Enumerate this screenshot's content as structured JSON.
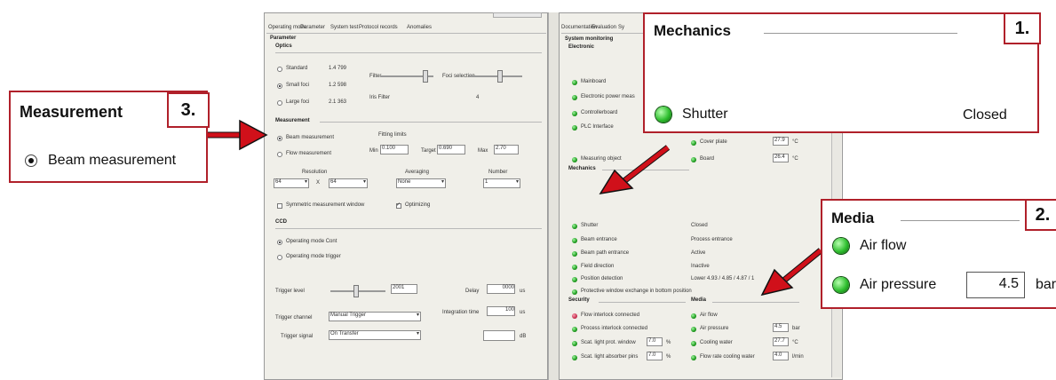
{
  "left_window": {
    "tabs": [
      "Operating mode",
      "Parameter",
      "System test",
      "Protocol records",
      "Anomalies"
    ],
    "group_title": "Parameter",
    "optics": {
      "title": "Optics",
      "options": [
        "Standard",
        "Small foci",
        "Large foci"
      ],
      "values": [
        "1.4 799",
        "1.2 598",
        "2.1 363"
      ],
      "slider1_label": "Filter",
      "slider2_label": "Foci selection",
      "extra_label": "Iris Filter",
      "extra_value": "4"
    },
    "measurement": {
      "title": "Measurement",
      "options": [
        "Beam measurement",
        "Flow measurement"
      ],
      "fitting_label": "Fitting limits",
      "min_label": "Min",
      "min_value": "0.100",
      "target_label": "Target",
      "target_value": "0.690",
      "max_label": "Max",
      "max_value": "2.70",
      "resolution_label": "Resolution",
      "averaging_label": "Averaging",
      "number_label": "Number",
      "res_x": "64",
      "res_x_sep": "X",
      "res_y": "64",
      "averaging_value": "None",
      "number_value": "1",
      "symmetric_label": "Symmetric measurement window",
      "optimizing_label": "Optimizing"
    },
    "ccd": {
      "title": "CCD",
      "options": [
        "Operating mode Cont",
        "Operating mode trigger"
      ],
      "trigger_level_label": "Trigger level",
      "trigger_level_value": "2001",
      "delay_label": "Delay",
      "delay_value": "0000",
      "delay_unit": "us",
      "integration_label": "Integration time",
      "integration_value": "100",
      "integration_unit": "us",
      "trigger_channel_label": "Trigger channel",
      "trigger_channel_value": "Manual Trigger",
      "trigger_signal_label": "Trigger signal",
      "trigger_signal_value": "On Transfer",
      "db_unit": "dB"
    }
  },
  "right_window": {
    "tabs": [
      "Documentation",
      "Evaluation",
      "Sy"
    ],
    "group_title": "System monitoring",
    "electronic": {
      "title": "Electronic",
      "items": [
        "Mainboard",
        "Electronic power meas",
        "Controllerboard",
        "PLC Interface"
      ]
    },
    "temps": [
      {
        "label": "Cover plate",
        "value": "27.9",
        "unit": "°C"
      },
      {
        "label": "Board",
        "value": "26.4",
        "unit": "°C"
      }
    ],
    "measuring_object": "Measuring object",
    "mechanics": {
      "title": "Mechanics",
      "items": [
        {
          "label": "Shutter",
          "value": "Closed"
        },
        {
          "label": "Beam entrance",
          "value": "Process entrance"
        },
        {
          "label": "Beam path entrance",
          "value": "Active"
        },
        {
          "label": "Field direction",
          "value": "Inactive"
        },
        {
          "label": "Position detection",
          "value": "Lower 4.93 / 4.85 / 4.87 / 1"
        }
      ],
      "protective": "Protective window exchange in bottom position"
    },
    "security": {
      "title": "Security",
      "items": [
        "Flow interlock connected",
        "Process interlock connected",
        "Scat. light prot. window",
        "Scat. light absorber pins"
      ],
      "values": [
        "7.0",
        "7.0"
      ],
      "unit": "%"
    },
    "media": {
      "title": "Media",
      "items": [
        "Air flow",
        "Air pressure",
        "Cooling water",
        "Flow rate cooling water"
      ],
      "values": [
        "",
        "4.5",
        "27.7",
        "4.0"
      ],
      "units": [
        "",
        "bar",
        "°C",
        "l/min"
      ]
    }
  },
  "callouts": {
    "mechanics": {
      "title": "Mechanics",
      "number": "1.",
      "led_label": "Shutter",
      "value": "Closed"
    },
    "media": {
      "title": "Media",
      "number": "2.",
      "row1": "Air flow",
      "row2": "Air pressure",
      "row2_value": "4.5",
      "row2_unit": "bar"
    },
    "measurement": {
      "title": "Measurement",
      "number": "3.",
      "option": "Beam measurement"
    }
  }
}
